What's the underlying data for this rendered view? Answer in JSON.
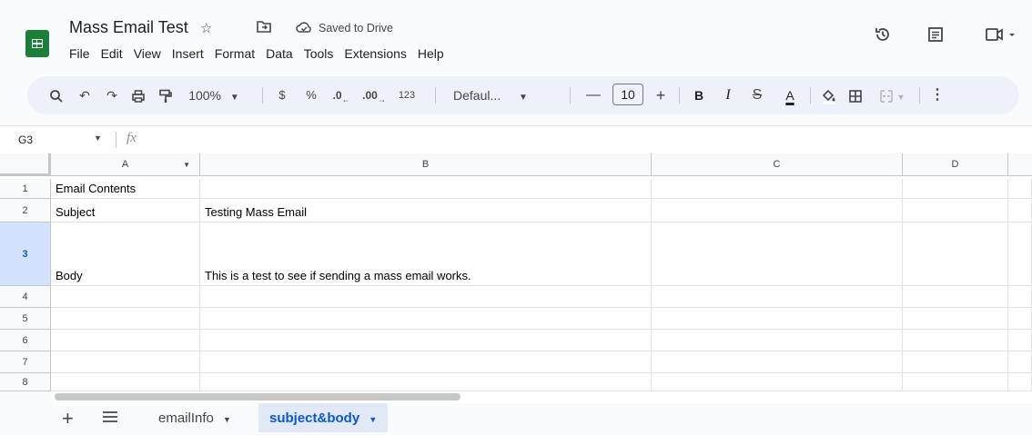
{
  "doc": {
    "title": "Mass Email Test",
    "saved_status": "Saved to Drive"
  },
  "menu": [
    "File",
    "Edit",
    "View",
    "Insert",
    "Format",
    "Data",
    "Tools",
    "Extensions",
    "Help"
  ],
  "toolbar": {
    "zoom": "100%",
    "currency": "$",
    "percent": "%",
    "dec_decrease": ".0",
    "dec_increase": ".00",
    "number_format": "123",
    "font": "Defaul...",
    "font_size": "10",
    "minus": "—",
    "plus": "+",
    "bold": "B",
    "italic": "I",
    "text_color": "A",
    "more": "⋮"
  },
  "formula_bar": {
    "cell_ref": "G3",
    "fx": "fx",
    "value": ""
  },
  "columns": [
    "A",
    "B",
    "C",
    "D"
  ],
  "rows": [
    {
      "num": "1",
      "cells": [
        "Email Contents",
        "",
        "",
        ""
      ]
    },
    {
      "num": "2",
      "cells": [
        "Subject",
        "Testing Mass Email",
        "",
        ""
      ]
    },
    {
      "num": "3",
      "cells": [
        "Body",
        "This is a test to see if sending a mass email works.",
        "",
        ""
      ]
    },
    {
      "num": "4",
      "cells": [
        "",
        "",
        "",
        ""
      ]
    },
    {
      "num": "5",
      "cells": [
        "",
        "",
        "",
        ""
      ]
    },
    {
      "num": "6",
      "cells": [
        "",
        "",
        "",
        ""
      ]
    },
    {
      "num": "7",
      "cells": [
        "",
        "",
        "",
        ""
      ]
    },
    {
      "num": "8",
      "cells": [
        "",
        "",
        "",
        ""
      ]
    }
  ],
  "sheets": [
    {
      "name": "emailInfo",
      "active": false
    },
    {
      "name": "subject&body",
      "active": true
    }
  ],
  "colors": {
    "accent": "#0b57d0",
    "logo": "#188038",
    "toolbar_bg": "#edf2fa"
  }
}
